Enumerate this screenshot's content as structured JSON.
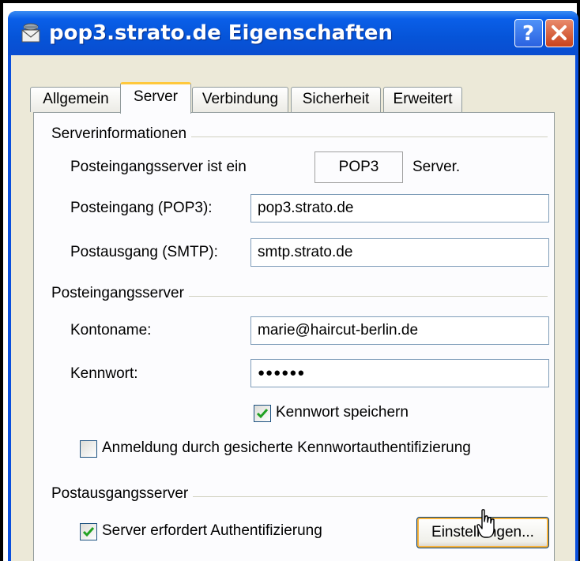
{
  "window": {
    "title": "pop3.strato.de Eigenschaften",
    "help_label": "?",
    "close_label": "X"
  },
  "tabs": [
    {
      "label": "Allgemein",
      "active": false
    },
    {
      "label": "Server",
      "active": true
    },
    {
      "label": "Verbindung",
      "active": false
    },
    {
      "label": "Sicherheit",
      "active": false
    },
    {
      "label": "Erweitert",
      "active": false
    }
  ],
  "server_info": {
    "group_label": "Serverinformationen",
    "incoming_type_label": "Posteingangsserver ist ein",
    "incoming_type_value": "POP3",
    "incoming_type_suffix": "Server.",
    "incoming_label": "Posteingang (POP3):",
    "incoming_value": "pop3.strato.de",
    "outgoing_label": "Postausgang (SMTP):",
    "outgoing_value": "smtp.strato.de"
  },
  "incoming_server": {
    "group_label": "Posteingangsserver",
    "account_label": "Kontoname:",
    "account_value": "marie@haircut-berlin.de",
    "password_label": "Kennwort:",
    "password_value": "●●●●●●",
    "save_password_label": "Kennwort speichern",
    "save_password_checked": true,
    "spa_label": "Anmeldung durch gesicherte Kennwortauthentifizierung",
    "spa_checked": false
  },
  "outgoing_server": {
    "group_label": "Postausgangsserver",
    "auth_label": "Server erfordert Authentifizierung",
    "auth_checked": true,
    "settings_button": "Einstellungen..."
  },
  "colors": {
    "titlebar": "#0a5fe8",
    "active_tab_highlight": "#ffc83c",
    "checkmark": "#21a121"
  }
}
